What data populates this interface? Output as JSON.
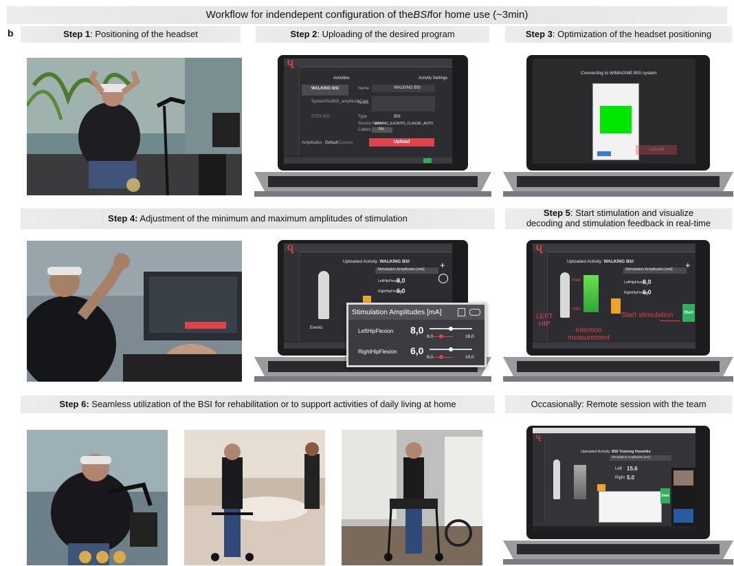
{
  "title": {
    "prefix": "Workflow for indendepent configuration of the ",
    "emph": "BSI",
    "suffix": " for home use (~3min)"
  },
  "panel_letter": "b",
  "steps": {
    "s1": {
      "bold": "Step 1",
      "text": ": Positioning of the headset"
    },
    "s2": {
      "bold": "Step 2",
      "text": ": Uploading of the desired program"
    },
    "s3": {
      "bold": "Step 3",
      "text": ": Optimization of the headset positioning"
    },
    "s4": {
      "bold": "Step 4:",
      "text": " Adjustment of the minimum and maximum amplitudes of stimulation"
    },
    "s5": {
      "bold": "Step 5",
      "text": ": Start stimulation and visualize",
      "line2": "decoding and stimulation feedback in real-time"
    },
    "s6": {
      "bold": "Step 6:",
      "text": " Seamless utilization of the BSI for rehabilitation or to support activities of daily living at home"
    },
    "s7": {
      "text": "Occasionally: Remote session with the team"
    }
  },
  "screen2": {
    "activities": "Activities",
    "settings": "Activity Settings",
    "item1": "WALKING BSI",
    "item2": "SystemTestBSI_amplitudeCont",
    "item3": "STEP BSI",
    "name_label": "Name",
    "name_value": "WALKING BSI",
    "notes_label": "Notes",
    "type_label": "Type",
    "type_value": "BSI",
    "source_label": "Source Name",
    "source_value": "WAKING_ILEONTO_CLASSIF_AUTO",
    "cables_label": "Cables",
    "cables_value": "No",
    "upload": "Upload",
    "amplitudes": "Amplitudes",
    "default": "Default",
    "custom": "Custom"
  },
  "screen3": {
    "connecting": "Connecting to WIMAGINE-BSI system",
    "upload": "Upload"
  },
  "screen4": {
    "uploaded_prefix": "Uploaded Activity: ",
    "uploaded_name": "WALKING BSI",
    "amp_header": "Stimulation Amplitudes [mA]",
    "left": "LeftHipFlexion",
    "left_val": "8,0",
    "right": "RightHipFlexion",
    "right_val": "6,0",
    "events": "Events"
  },
  "popup": {
    "header": "Stimulation Amplitudes [mA]",
    "left_label": "LeftHipFlexion",
    "left_value": "8,0",
    "left_min": "8,0",
    "left_max": "16,0",
    "right_label": "RightHipFlexion",
    "right_value": "6,0",
    "right_min": "6,0",
    "right_max": "10,0"
  },
  "screen5": {
    "uploaded_prefix": "Uploaded Activity: ",
    "uploaded_name": "WALKING BSI",
    "amp_header": "Stimulation Amplitudes [mA]",
    "left": "LeftHipFlexion",
    "left_val": "8,0",
    "right": "RightHipFlexion",
    "right_val": "6,0",
    "max": "max",
    "min": "min",
    "start": "Start",
    "left_hip_1": "LEFT",
    "left_hip_2": "HIP",
    "intention_1": "Intention",
    "intention_2": "measurement",
    "start_stim": "Start stimulation"
  },
  "screen7": {
    "uploaded_prefix": "Uploaded Activity: ",
    "uploaded_name": "BSI Training Homeike",
    "amp_header": "Stimulation Amplitudes [mA]",
    "left": "Left",
    "left_val": "15.6",
    "right": "Right",
    "right_val": "5.0",
    "start": "Start"
  }
}
